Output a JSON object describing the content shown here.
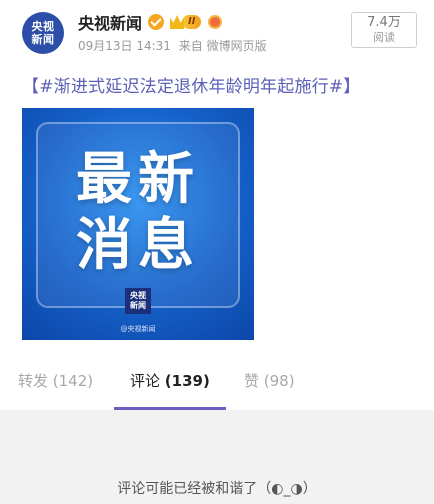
{
  "header": {
    "avatar_line1": "央视",
    "avatar_line2": "新闻",
    "name": "央视新闻",
    "vip_level": "II",
    "date": "09月13日 14:31",
    "source": "来自 微博网页版",
    "views_count": "7.4万",
    "views_label": "阅读"
  },
  "post": {
    "text": "【#渐进式延迟法定退休年龄明年起施行#】",
    "image": {
      "line1": "最新",
      "line2": "消息",
      "logo_line1": "央视",
      "logo_line2": "新闻",
      "watermark": "@央视新闻"
    }
  },
  "tabs": {
    "repost": "转发 (142)",
    "comment_label": "评论",
    "comment_count": "(139)",
    "like": "赞 (98)"
  },
  "comments": {
    "empty_message": "评论可能已经被和谐了（◐_◑）"
  },
  "colors": {
    "accent": "#6a5fc1",
    "topic_text": "#5b5fb8",
    "comment_bg": "#f2f2f2"
  }
}
